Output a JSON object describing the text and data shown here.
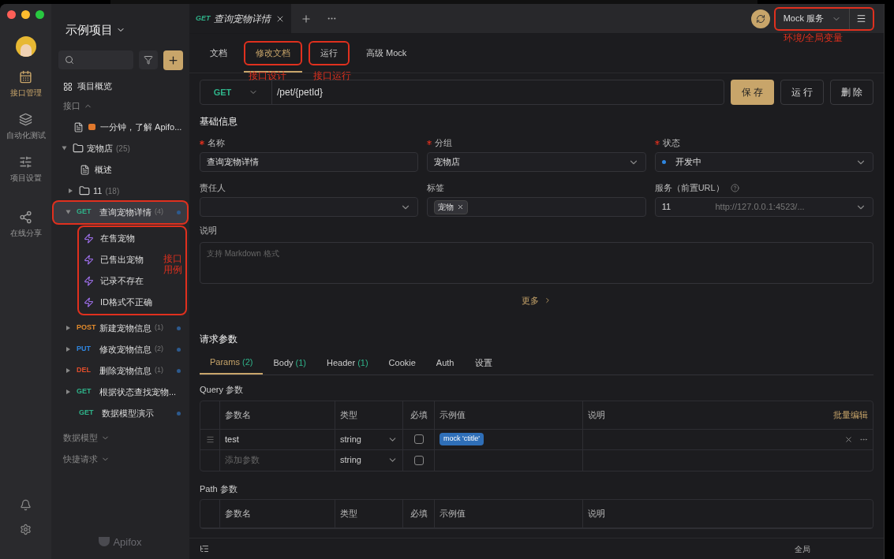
{
  "rail": {
    "items": [
      {
        "label": "接口管理",
        "selected": true
      },
      {
        "label": "自动化测试",
        "selected": false
      },
      {
        "label": "项目设置",
        "selected": false
      },
      {
        "label": "在线分享",
        "selected": false
      }
    ]
  },
  "sidebar": {
    "project": "示例项目",
    "overview": "项目概览",
    "section": "接口",
    "brand": "Apifox",
    "tree": [
      {
        "kind": "doc",
        "label": "一分钟，了解 Apifo..."
      },
      {
        "kind": "folder",
        "label": "宠物店",
        "count": "(25)",
        "expanded": true,
        "children": [
          {
            "kind": "doc",
            "label": "概述"
          },
          {
            "kind": "folder",
            "label": "11",
            "count": "(18)",
            "expanded": false
          },
          {
            "kind": "api",
            "method": "GET",
            "label": "查询宠物详情",
            "count": "(4)",
            "expanded": true,
            "selected": true,
            "annotated": true,
            "dot": true,
            "cases_annotation": "接口用例",
            "cases": [
              "在售宠物",
              "已售出宠物",
              "记录不存在",
              "ID格式不正确"
            ]
          },
          {
            "kind": "api",
            "method": "POST",
            "label": "新建宠物信息",
            "count": "(1)",
            "expanded": false,
            "selected": false,
            "dot": true
          },
          {
            "kind": "api",
            "method": "PUT",
            "label": "修改宠物信息",
            "count": "(2)",
            "expanded": false,
            "selected": false,
            "dot": true
          },
          {
            "kind": "api",
            "method": "DEL",
            "label": "删除宠物信息",
            "count": "(1)",
            "expanded": false,
            "selected": false,
            "dot": true
          },
          {
            "kind": "api",
            "method": "GET",
            "label": "根据状态查找宠物...",
            "expanded": false,
            "selected": false,
            "dot": false
          },
          {
            "kind": "api",
            "method": "GET",
            "label": "数据模型演示",
            "selected": false,
            "dot": true
          }
        ]
      }
    ],
    "sections": [
      "数据模型",
      "快捷请求"
    ]
  },
  "tab": {
    "method": "GET",
    "title": "查询宠物详情"
  },
  "env": {
    "label": "Mock 服务",
    "annotation": "环境/全局变量"
  },
  "doc_tabs": [
    {
      "label": "文档",
      "selected": false
    },
    {
      "label": "修改文档",
      "selected": true,
      "annotation": "接口设计"
    },
    {
      "label": "运行",
      "selected": false,
      "annotation": "接口运行"
    },
    {
      "label": "高级 Mock",
      "selected": false
    }
  ],
  "url": {
    "method": "GET",
    "path": "/pet/{petId}"
  },
  "actions": [
    {
      "label": "保 存",
      "primary": true
    },
    {
      "label": "运 行",
      "primary": false
    },
    {
      "label": "删 除",
      "primary": false
    }
  ],
  "basic": {
    "title": "基础信息",
    "fields": [
      {
        "label": "名称",
        "required": true,
        "kind": "text",
        "value": "查询宠物详情"
      },
      {
        "label": "分组",
        "required": true,
        "kind": "select",
        "value": "宠物店"
      },
      {
        "label": "状态",
        "required": true,
        "kind": "status",
        "value": "开发中"
      },
      {
        "label": "责任人",
        "required": false,
        "kind": "select"
      },
      {
        "label": "标签",
        "required": false,
        "kind": "tags",
        "tags": [
          "宠物"
        ]
      },
      {
        "label": "服务（前置URL）",
        "required": false,
        "kind": "service",
        "value": "11",
        "hint": "http://127.0.0.1:4523/..."
      }
    ],
    "desc_label": "说明",
    "desc_placeholder": "支持 Markdown 格式",
    "more": "更多"
  },
  "request": {
    "title": "请求参数",
    "tabs": [
      {
        "label": "Params",
        "count": "(2)",
        "selected": true
      },
      {
        "label": "Body",
        "count": "(1)",
        "selected": false
      },
      {
        "label": "Header",
        "count": "(1)",
        "selected": false
      },
      {
        "label": "Cookie",
        "selected": false
      },
      {
        "label": "Auth",
        "selected": false
      },
      {
        "label": "设置",
        "selected": false
      }
    ],
    "query": {
      "title": "Query 参数",
      "columns": [
        "参数名",
        "类型",
        "必填",
        "示例值",
        "说明"
      ],
      "bulk": "批量编辑",
      "rows": [
        {
          "name": "test",
          "type": "string",
          "required": false,
          "example": "mock 'ctitle'"
        },
        {
          "placeholder": "添加参数",
          "type": "string",
          "required": false
        }
      ]
    },
    "path": {
      "title": "Path 参数",
      "columns": [
        "参数名",
        "类型",
        "必填",
        "示例值",
        "说明"
      ]
    }
  },
  "status_bar": {
    "text": "全局"
  }
}
